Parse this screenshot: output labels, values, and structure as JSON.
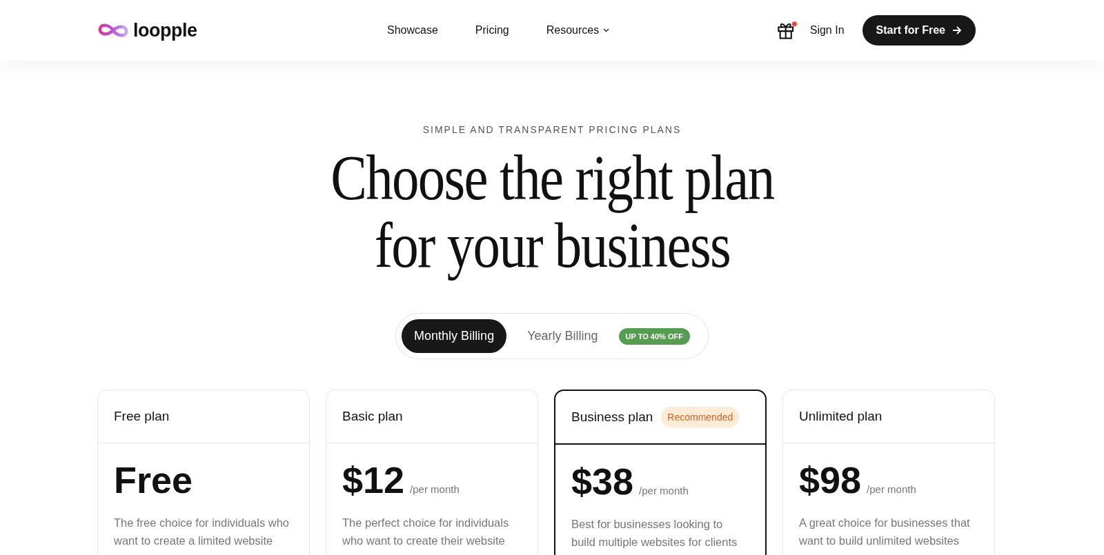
{
  "header": {
    "logo": "loopple",
    "nav": [
      {
        "label": "Showcase",
        "dropdown": false
      },
      {
        "label": "Pricing",
        "dropdown": false
      },
      {
        "label": "Resources",
        "dropdown": true
      }
    ],
    "notification": true,
    "sign_in": "Sign In",
    "cta": "Start for Free"
  },
  "hero": {
    "eyebrow": "SIMPLE AND TRANSPARENT PRICING PLANS",
    "title_lines": [
      "Choose the right plan",
      "for your business"
    ]
  },
  "billing": {
    "options": [
      {
        "label": "Monthly Billing",
        "selected": true
      },
      {
        "label": "Yearly Billing",
        "selected": false,
        "badge": "UP TO 40% OFF"
      }
    ]
  },
  "plans": [
    {
      "name": "Free plan",
      "featured": false,
      "price": "Free",
      "description": "The free choice for individuals who want to create a limited website"
    },
    {
      "name": "Basic plan",
      "featured": false,
      "price": "$12",
      "period": "/per month",
      "description": "The perfect choice for individuals who want to create their website"
    },
    {
      "name": "Business plan",
      "featured": true,
      "badge": "Recommended",
      "price": "$38",
      "period": "/per month",
      "description": "Best for businesses looking to build multiple websites for clients"
    },
    {
      "name": "Unlimited plan",
      "featured": false,
      "price": "$98",
      "period": "/per month",
      "description": "A great choice for businesses that want to build unlimited websites"
    }
  ]
}
